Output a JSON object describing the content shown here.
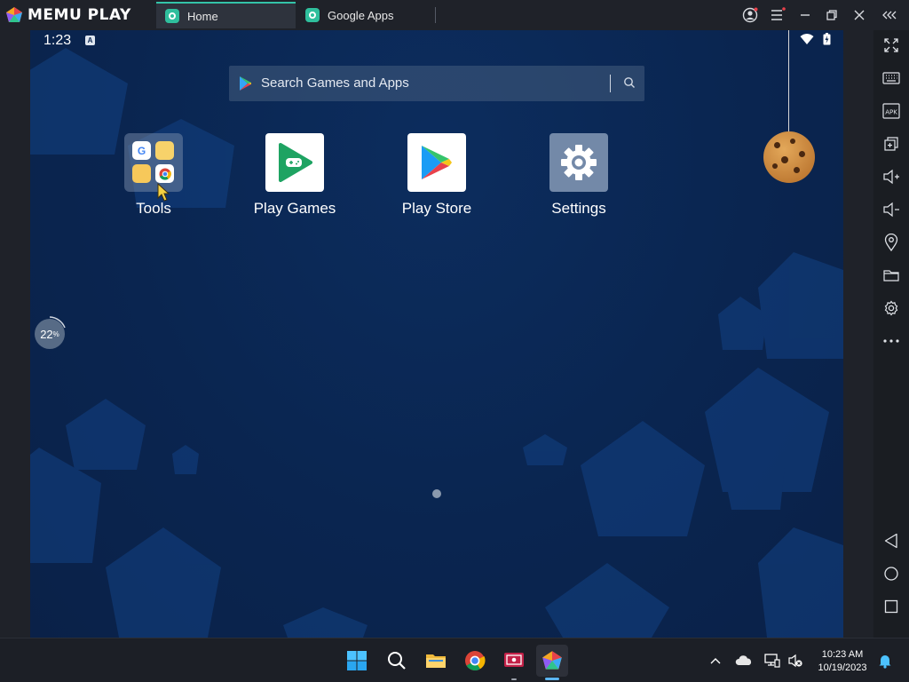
{
  "app": {
    "brand": "MEMU PLAY"
  },
  "tabs": [
    {
      "label": "Home",
      "active": true
    },
    {
      "label": "Google Apps",
      "active": false
    }
  ],
  "android": {
    "status": {
      "time": "1:23",
      "notif_badge": "A"
    },
    "search": {
      "placeholder": "Search Games and Apps"
    },
    "apps": [
      {
        "label": "Tools",
        "type": "folder"
      },
      {
        "label": "Play Games"
      },
      {
        "label": "Play Store"
      },
      {
        "label": "Settings"
      }
    ],
    "memory_widget": {
      "value": "22",
      "unit": "%"
    },
    "page_indicator": {
      "pages": 1,
      "current": 1
    }
  },
  "sidebar": {
    "tools": [
      "fullscreen-icon",
      "keyboard-icon",
      "apk-icon",
      "multi-instance-icon",
      "volume-up-icon",
      "volume-down-icon",
      "location-icon",
      "folder-icon",
      "settings-icon",
      "more-icon"
    ],
    "nav": [
      "back-icon",
      "home-icon",
      "recents-icon"
    ],
    "apk_label": "APK"
  },
  "taskbar": {
    "apps": [
      "windows-start-icon",
      "search-icon",
      "file-explorer-icon",
      "chrome-icon",
      "media-app-icon",
      "memu-icon"
    ],
    "clock": {
      "time": "10:23 AM",
      "date": "10/19/2023"
    }
  },
  "colors": {
    "accent": "#34c4a8",
    "screen_bg": "#0a2550",
    "chrome": "#1f2229"
  }
}
